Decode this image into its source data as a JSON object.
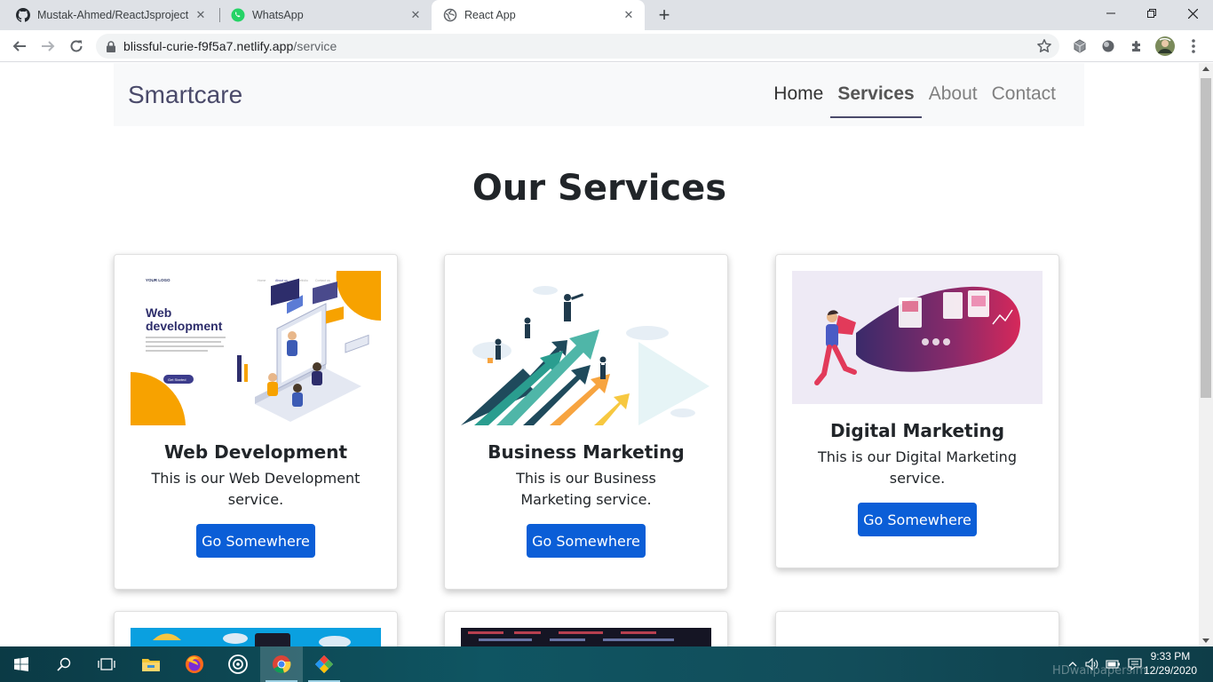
{
  "browser": {
    "tabs": [
      {
        "title": "Mustak-Ahmed/ReactJsproject",
        "icon": "github-icon",
        "active": false
      },
      {
        "title": "WhatsApp",
        "icon": "whatsapp-icon",
        "active": false
      },
      {
        "title": "React App",
        "icon": "globe-icon",
        "active": true
      }
    ],
    "url_host": "blissful-curie-f9f5a7.netlify.app",
    "url_path": "/service"
  },
  "site": {
    "brand": "Smartcare",
    "nav": [
      {
        "label": "Home",
        "state": "default"
      },
      {
        "label": "Services",
        "state": "active"
      },
      {
        "label": "About",
        "state": "muted"
      },
      {
        "label": "Contact",
        "state": "muted"
      }
    ],
    "heading": "Our Services",
    "cards": [
      {
        "title": "Web Development",
        "text": "This is our Web Development service.",
        "button": "Go Somewhere",
        "image": {
          "type": "web-development-illustration",
          "logo_text": "YOUR LOGO",
          "headline": "Web development",
          "cta": "Get Started"
        }
      },
      {
        "title": "Business Marketing",
        "text": "This is our Business Marketing service.",
        "button": "Go Somewhere",
        "image": {
          "type": "business-growth-illustration"
        }
      },
      {
        "title": "Digital Marketing",
        "text": "This is our Digital Marketing service.",
        "button": "Go Somewhere",
        "image": {
          "type": "megaphone-illustration"
        }
      }
    ],
    "accent_color": "#0b5ed7"
  },
  "taskbar": {
    "time": "9:33 PM",
    "date": "12/29/2020",
    "apps": [
      "start-icon",
      "search-icon",
      "task-view-icon",
      "file-explorer-icon",
      "firefox-icon",
      "obs-icon",
      "chrome-icon",
      "app-icon"
    ]
  },
  "watermark": "HDwallpapersim"
}
